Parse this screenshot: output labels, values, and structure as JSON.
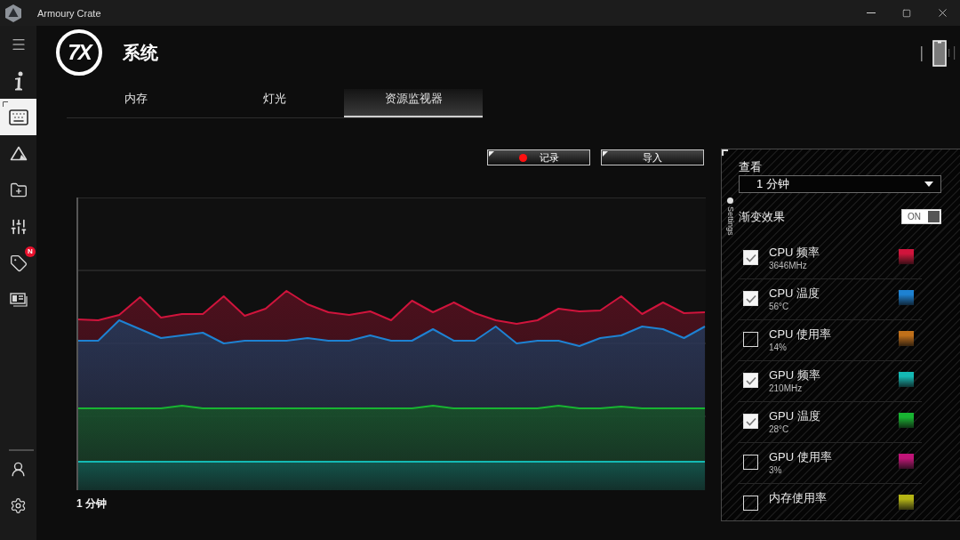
{
  "window": {
    "title": "Armoury Crate"
  },
  "sidebar": {
    "items": [
      {
        "kind": "menu",
        "selected": false
      },
      {
        "kind": "info",
        "selected": false
      },
      {
        "kind": "keyboard",
        "selected": true
      },
      {
        "kind": "triangle",
        "selected": false
      },
      {
        "kind": "folder",
        "selected": false
      },
      {
        "kind": "sliders",
        "selected": false
      },
      {
        "kind": "tag",
        "selected": false,
        "badge": "N"
      },
      {
        "kind": "card",
        "selected": false
      }
    ],
    "bottom_items": [
      {
        "kind": "user",
        "selected": false
      },
      {
        "kind": "gear",
        "selected": false
      }
    ]
  },
  "header": {
    "logo": "7X",
    "title": "系统"
  },
  "tabs": [
    {
      "label": "内存",
      "selected": false
    },
    {
      "label": "灯光",
      "selected": false
    },
    {
      "label": "资源监视器",
      "selected": true
    }
  ],
  "actions": [
    {
      "kind": "record",
      "label": "记录"
    },
    {
      "kind": "import",
      "label": "导入"
    }
  ],
  "chart": {
    "time_label": "1 分钟"
  },
  "settings_panel": {
    "tab_label": "Settings",
    "view_label": "查看",
    "view_select": {
      "value": "1 分钟"
    },
    "gradient_effect": {
      "label": "渐变效果",
      "on": true,
      "switch_label": "ON"
    },
    "metrics": [
      {
        "name": "CPU 频率",
        "reading": "3646MHz",
        "checked": true,
        "color": "#d0143c"
      },
      {
        "name": "CPU 温度",
        "reading": "56°C",
        "checked": true,
        "color": "#1e82d2"
      },
      {
        "name": "CPU 使用率",
        "reading": "14%",
        "checked": false,
        "color": "#c0701a"
      },
      {
        "name": "GPU 频率",
        "reading": "210MHz",
        "checked": true,
        "color": "#14b9b4"
      },
      {
        "name": "GPU 温度",
        "reading": "28°C",
        "checked": true,
        "color": "#18b432"
      },
      {
        "name": "GPU 使用率",
        "reading": "3%",
        "checked": false,
        "color": "#c01478"
      },
      {
        "name": "内存使用率",
        "checked": false,
        "color": "#b4b414"
      }
    ]
  }
}
